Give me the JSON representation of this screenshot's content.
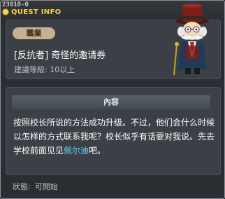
{
  "quest_id": "23010-0",
  "window": {
    "title": "QUEST INFO"
  },
  "header": {
    "job_badge": "職業",
    "quest_name": "[反抗者] 奇怪的邀请券",
    "recommended_level": "建議等級: 10以上"
  },
  "content": {
    "heading": "內容",
    "text_before": "按照校长所说的方法成功升级。不过，他们会什么时候以怎样的方式联系我呢？校长似乎有话要对我说。先去学校前面见见",
    "npc_name": "佩尔迪",
    "text_after": "吧。"
  },
  "status": {
    "label": "狀態:",
    "value": "可開始"
  },
  "colors": {
    "title": "#f2d24a",
    "npc_highlight": "#5fd3f0",
    "badge": "#c6b08f"
  },
  "icons": [
    "quest-info-icon",
    "npc-character-portrait"
  ]
}
